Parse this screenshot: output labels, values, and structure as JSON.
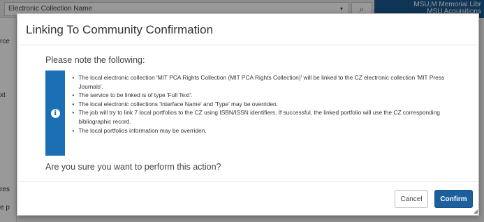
{
  "background": {
    "select_label": "Electronic Collection Name",
    "brand_line1": "MSU,M Memorial Libr",
    "brand_line2": "MSU Acquisitions",
    "fragment_1": "rce",
    "fragment_2": "xt",
    "fragment_3": "res",
    "fragment_4": "e p"
  },
  "dialog": {
    "title": "Linking To Community Confirmation",
    "intro": "Please note the following:",
    "notes": [
      "The local electronic collection 'MIT PCA Rights Collection (MIT PCA Rights Collection)' will be linked to the CZ electronic collection 'MIT Press Journals'.",
      "The service to be linked is of type 'Full Text'.",
      "The local electronic collections 'Interface Name' and 'Type' may be overriden.",
      "The job will try to link 7 local portfolios to the CZ using ISBN/ISSN identifiers. If successful, the linked portfolio will use the CZ corresponding bibliographic record.",
      "The local portfolios information may be overriden."
    ],
    "question": "Are you sure you want to perform this action?",
    "cancel_label": "Cancel",
    "confirm_label": "Confirm",
    "info_icon": "info-icon",
    "accent_color": "#1b6fb5"
  }
}
